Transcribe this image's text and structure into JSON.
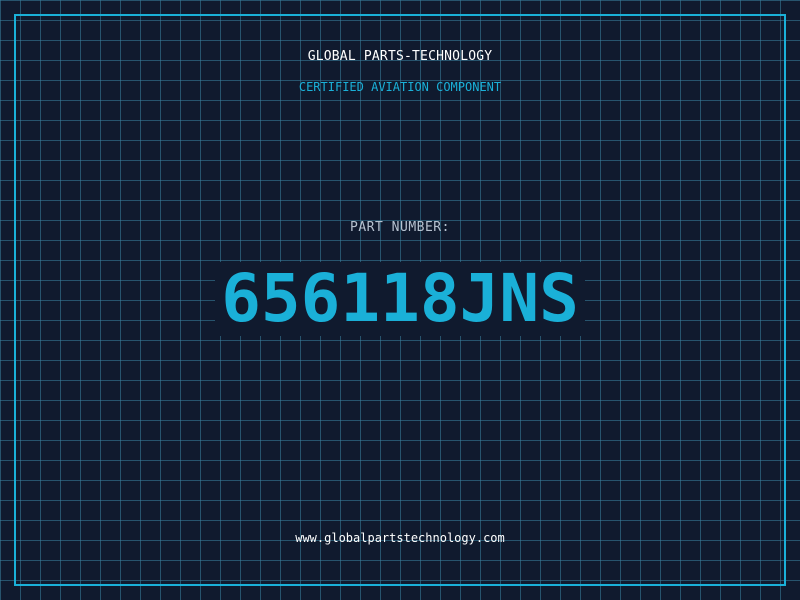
{
  "header": {
    "company": "GLOBAL PARTS-TECHNOLOGY",
    "subtitle": "CERTIFIED AVIATION COMPONENT"
  },
  "part": {
    "label": "PART NUMBER:",
    "number": "656118JNS"
  },
  "footer": {
    "website": "www.globalpartstechnology.com"
  },
  "colors": {
    "background": "#101a2e",
    "grid": "#3a82a0",
    "accent": "#1ab0d8",
    "text_primary": "#ffffff",
    "text_muted": "#b7c2d0"
  }
}
